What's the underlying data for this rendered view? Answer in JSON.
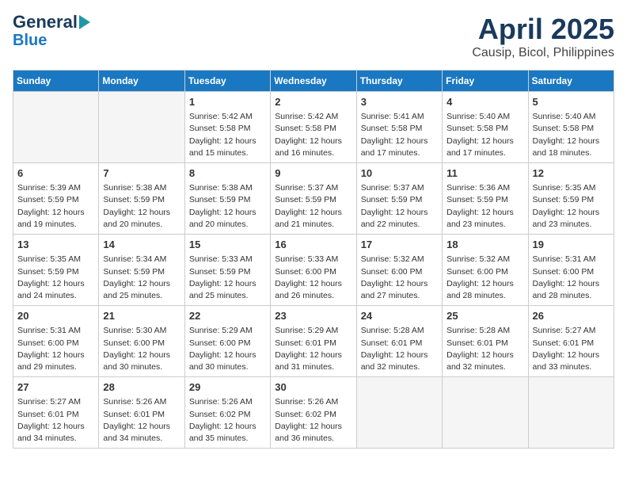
{
  "header": {
    "logo_line1": "General",
    "logo_line2": "Blue",
    "title": "April 2025",
    "subtitle": "Causip, Bicol, Philippines"
  },
  "days_of_week": [
    "Sunday",
    "Monday",
    "Tuesday",
    "Wednesday",
    "Thursday",
    "Friday",
    "Saturday"
  ],
  "weeks": [
    [
      {
        "day": "",
        "info": ""
      },
      {
        "day": "",
        "info": ""
      },
      {
        "day": "1",
        "info": "Sunrise: 5:42 AM\nSunset: 5:58 PM\nDaylight: 12 hours and 15 minutes."
      },
      {
        "day": "2",
        "info": "Sunrise: 5:42 AM\nSunset: 5:58 PM\nDaylight: 12 hours and 16 minutes."
      },
      {
        "day": "3",
        "info": "Sunrise: 5:41 AM\nSunset: 5:58 PM\nDaylight: 12 hours and 17 minutes."
      },
      {
        "day": "4",
        "info": "Sunrise: 5:40 AM\nSunset: 5:58 PM\nDaylight: 12 hours and 17 minutes."
      },
      {
        "day": "5",
        "info": "Sunrise: 5:40 AM\nSunset: 5:58 PM\nDaylight: 12 hours and 18 minutes."
      }
    ],
    [
      {
        "day": "6",
        "info": "Sunrise: 5:39 AM\nSunset: 5:59 PM\nDaylight: 12 hours and 19 minutes."
      },
      {
        "day": "7",
        "info": "Sunrise: 5:38 AM\nSunset: 5:59 PM\nDaylight: 12 hours and 20 minutes."
      },
      {
        "day": "8",
        "info": "Sunrise: 5:38 AM\nSunset: 5:59 PM\nDaylight: 12 hours and 20 minutes."
      },
      {
        "day": "9",
        "info": "Sunrise: 5:37 AM\nSunset: 5:59 PM\nDaylight: 12 hours and 21 minutes."
      },
      {
        "day": "10",
        "info": "Sunrise: 5:37 AM\nSunset: 5:59 PM\nDaylight: 12 hours and 22 minutes."
      },
      {
        "day": "11",
        "info": "Sunrise: 5:36 AM\nSunset: 5:59 PM\nDaylight: 12 hours and 23 minutes."
      },
      {
        "day": "12",
        "info": "Sunrise: 5:35 AM\nSunset: 5:59 PM\nDaylight: 12 hours and 23 minutes."
      }
    ],
    [
      {
        "day": "13",
        "info": "Sunrise: 5:35 AM\nSunset: 5:59 PM\nDaylight: 12 hours and 24 minutes."
      },
      {
        "day": "14",
        "info": "Sunrise: 5:34 AM\nSunset: 5:59 PM\nDaylight: 12 hours and 25 minutes."
      },
      {
        "day": "15",
        "info": "Sunrise: 5:33 AM\nSunset: 5:59 PM\nDaylight: 12 hours and 25 minutes."
      },
      {
        "day": "16",
        "info": "Sunrise: 5:33 AM\nSunset: 6:00 PM\nDaylight: 12 hours and 26 minutes."
      },
      {
        "day": "17",
        "info": "Sunrise: 5:32 AM\nSunset: 6:00 PM\nDaylight: 12 hours and 27 minutes."
      },
      {
        "day": "18",
        "info": "Sunrise: 5:32 AM\nSunset: 6:00 PM\nDaylight: 12 hours and 28 minutes."
      },
      {
        "day": "19",
        "info": "Sunrise: 5:31 AM\nSunset: 6:00 PM\nDaylight: 12 hours and 28 minutes."
      }
    ],
    [
      {
        "day": "20",
        "info": "Sunrise: 5:31 AM\nSunset: 6:00 PM\nDaylight: 12 hours and 29 minutes."
      },
      {
        "day": "21",
        "info": "Sunrise: 5:30 AM\nSunset: 6:00 PM\nDaylight: 12 hours and 30 minutes."
      },
      {
        "day": "22",
        "info": "Sunrise: 5:29 AM\nSunset: 6:00 PM\nDaylight: 12 hours and 30 minutes."
      },
      {
        "day": "23",
        "info": "Sunrise: 5:29 AM\nSunset: 6:01 PM\nDaylight: 12 hours and 31 minutes."
      },
      {
        "day": "24",
        "info": "Sunrise: 5:28 AM\nSunset: 6:01 PM\nDaylight: 12 hours and 32 minutes."
      },
      {
        "day": "25",
        "info": "Sunrise: 5:28 AM\nSunset: 6:01 PM\nDaylight: 12 hours and 32 minutes."
      },
      {
        "day": "26",
        "info": "Sunrise: 5:27 AM\nSunset: 6:01 PM\nDaylight: 12 hours and 33 minutes."
      }
    ],
    [
      {
        "day": "27",
        "info": "Sunrise: 5:27 AM\nSunset: 6:01 PM\nDaylight: 12 hours and 34 minutes."
      },
      {
        "day": "28",
        "info": "Sunrise: 5:26 AM\nSunset: 6:01 PM\nDaylight: 12 hours and 34 minutes."
      },
      {
        "day": "29",
        "info": "Sunrise: 5:26 AM\nSunset: 6:02 PM\nDaylight: 12 hours and 35 minutes."
      },
      {
        "day": "30",
        "info": "Sunrise: 5:26 AM\nSunset: 6:02 PM\nDaylight: 12 hours and 36 minutes."
      },
      {
        "day": "",
        "info": ""
      },
      {
        "day": "",
        "info": ""
      },
      {
        "day": "",
        "info": ""
      }
    ]
  ]
}
